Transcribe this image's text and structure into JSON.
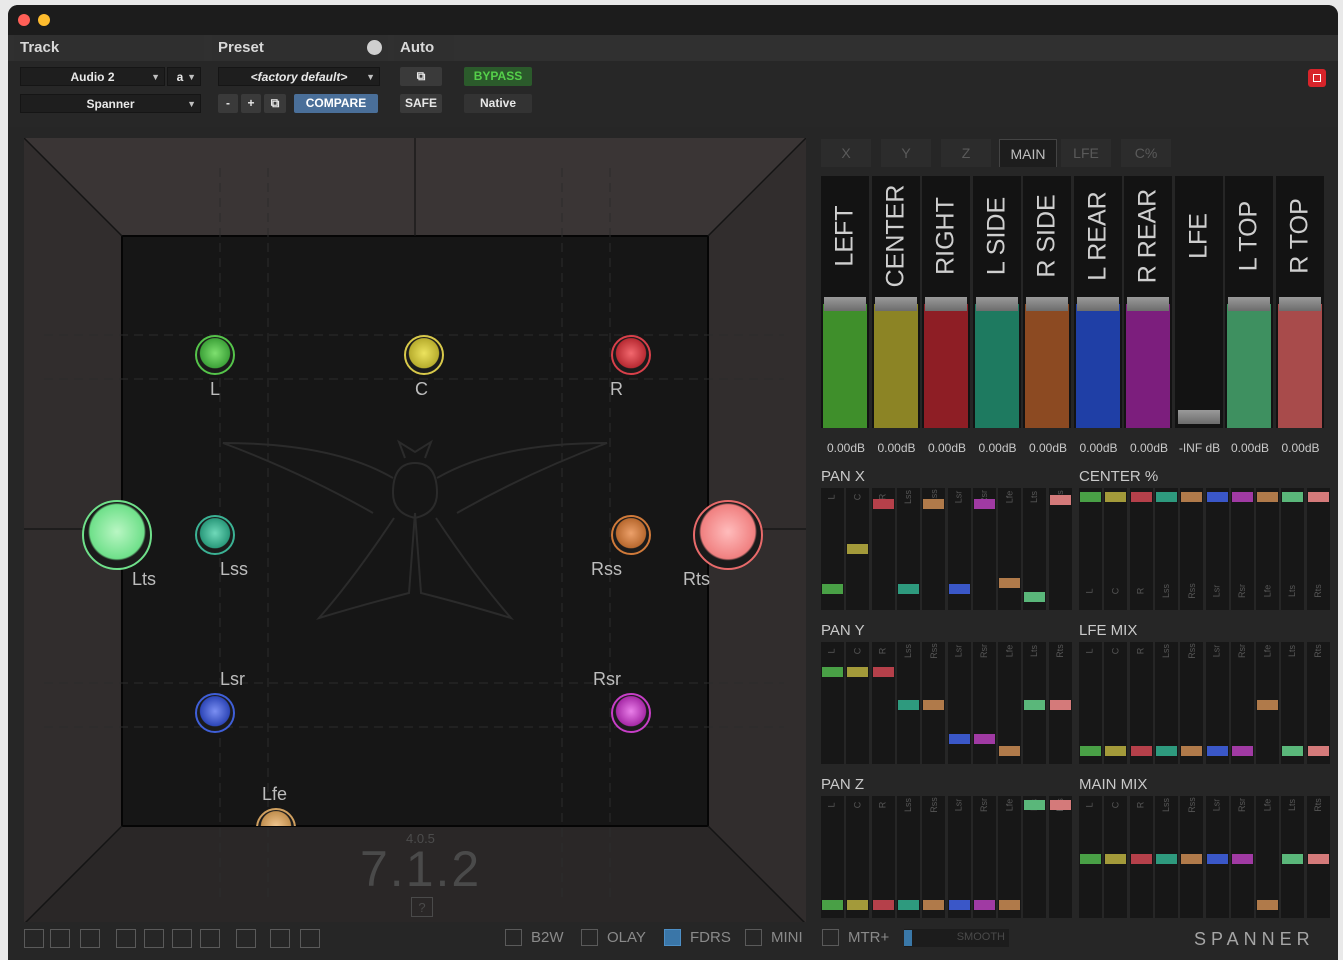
{
  "header": {
    "track": "Track",
    "preset": "Preset",
    "auto": "Auto"
  },
  "toolbar": {
    "track_name": "Audio 2",
    "track_sel": "a",
    "plugin_name": "Spanner",
    "preset_name": "<factory default>",
    "minus": "-",
    "plus": "+",
    "compare": "COMPARE",
    "safe": "SAFE",
    "bypass": "BYPASS",
    "native": "Native"
  },
  "pan": {
    "speakers": [
      "L",
      "C",
      "R",
      "Lts",
      "Lss",
      "Rss",
      "Rts",
      "Lsr",
      "Rsr",
      "Lfe"
    ],
    "format_small": "4.0.5",
    "format": "7.1.2",
    "format_button": "?"
  },
  "tabs": [
    "X",
    "Y",
    "Z",
    "MAIN",
    "LFE",
    "C%"
  ],
  "active_tab": "MAIN",
  "channels": [
    {
      "name": "LEFT",
      "db": "0.00dB",
      "color": "#3f8f2b"
    },
    {
      "name": "CENTER",
      "db": "0.00dB",
      "color": "#8c8425"
    },
    {
      "name": "RIGHT",
      "db": "0.00dB",
      "color": "#8e1e25"
    },
    {
      "name": "L SIDE",
      "db": "0.00dB",
      "color": "#1e7a60"
    },
    {
      "name": "R SIDE",
      "db": "0.00dB",
      "color": "#8c4a22"
    },
    {
      "name": "L REAR",
      "db": "0.00dB",
      "color": "#1f3fa6"
    },
    {
      "name": "R REAR",
      "db": "0.00dB",
      "color": "#7c1e7d"
    },
    {
      "name": "LFE",
      "db": "-INF dB",
      "color": "#1a1a1a"
    },
    {
      "name": "L TOP",
      "db": "0.00dB",
      "color": "#3e9060"
    },
    {
      "name": "R TOP",
      "db": "0.00dB",
      "color": "#a84b4b"
    }
  ],
  "matrix_titles": [
    "PAN X",
    "CENTER %",
    "PAN Y",
    "LFE MIX",
    "PAN Z",
    "MAIN MIX"
  ],
  "matrix_labels": [
    "L",
    "C",
    "R",
    "Lss",
    "Rss",
    "Lsr",
    "Rsr",
    "Lfe",
    "Lts",
    "Rts"
  ],
  "options": [
    {
      "label": "B2W",
      "checked": false
    },
    {
      "label": "OLAY",
      "checked": false
    },
    {
      "label": "FDRS",
      "checked": true
    },
    {
      "label": "MINI",
      "checked": false
    },
    {
      "label": "MTR+",
      "checked": false
    }
  ],
  "smooth_label": "SMOOTH",
  "brand": "SPANNER"
}
